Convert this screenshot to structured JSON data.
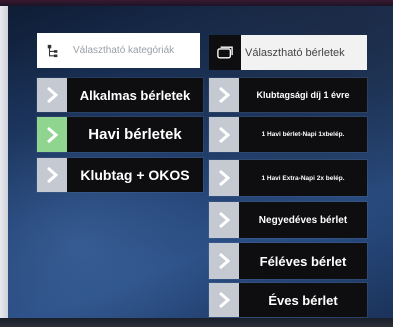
{
  "left_panel": {
    "header_text": "Választható kategóriák",
    "header_icon": "tree-hierarchy-icon",
    "categories": [
      {
        "label": "Alkalmas bérletek",
        "icon": "chevron-right-icon",
        "active": false
      },
      {
        "label": "Havi bérletek",
        "icon": "chevron-right-icon",
        "active": true
      },
      {
        "label": "Klubtag + OKOS",
        "icon": "chevron-right-icon",
        "active": false
      }
    ]
  },
  "right_panel": {
    "header_text": "Választható bérletek",
    "header_icon": "card-icon",
    "passes": [
      {
        "label": "Klubtagsági díj 1 évre"
      },
      {
        "label": "1 Havi bérlet-Napi 1xbelép."
      },
      {
        "label": "1 Havi Extra-Napi 2x belép."
      },
      {
        "label": "Negyedéves bérlet"
      },
      {
        "label": "Féléves bérlet"
      },
      {
        "label": "Éves bérlet"
      }
    ]
  },
  "colors": {
    "button_bg": "#0e0e10",
    "tab_bg": "#c4c9d2",
    "active_tab_bg": "#8fd48f",
    "header_bg": "#ffffff"
  }
}
